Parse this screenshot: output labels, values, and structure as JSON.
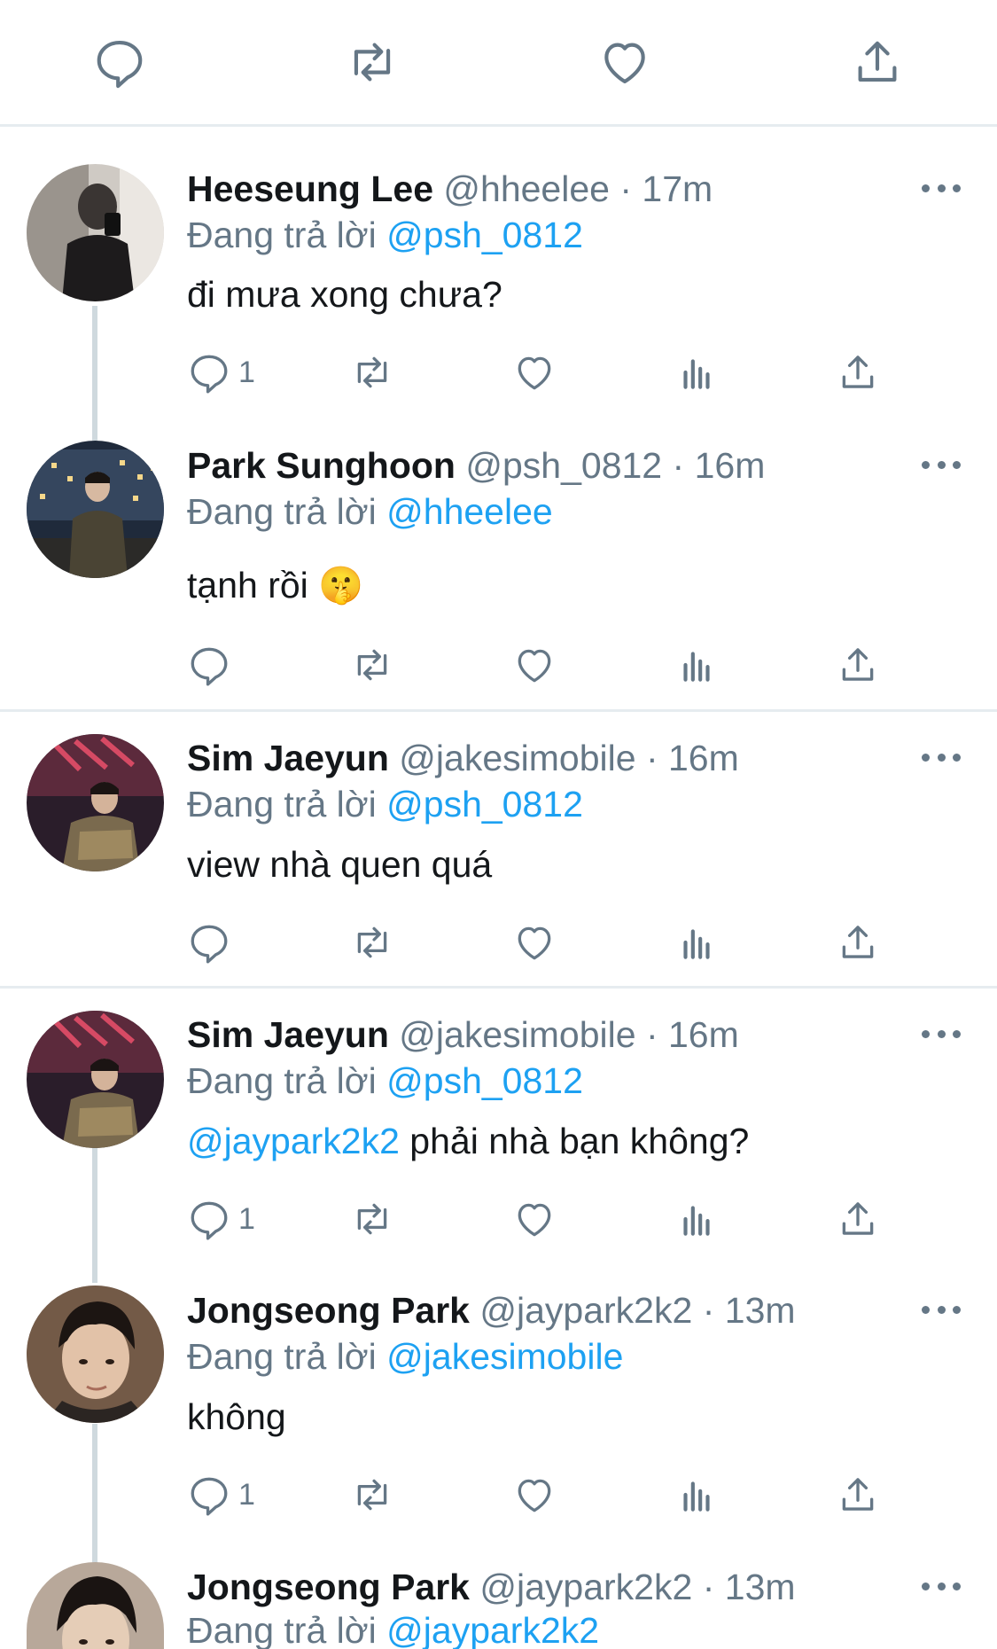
{
  "top_actions": [
    "reply",
    "retweet",
    "like",
    "share"
  ],
  "tweets": [
    {
      "name": "Heeseung Lee",
      "handle": "@hheelee",
      "time": "17m",
      "reply_prefix": "Đang trả lời",
      "reply_to": "@psh_0812",
      "text": "đi mưa xong chưa?",
      "reply_count": "1"
    },
    {
      "name": "Park Sunghoon",
      "handle": "@psh_0812",
      "time": "16m",
      "reply_prefix": "Đang trả lời",
      "reply_to": "@hheelee",
      "text": "tạnh rồi 🤫",
      "reply_count": ""
    },
    {
      "name": "Sim Jaeyun",
      "handle": "@jakesimobile",
      "time": "16m",
      "reply_prefix": "Đang trả lời",
      "reply_to": "@psh_0812",
      "text": "view nhà quen quá",
      "reply_count": ""
    },
    {
      "name": "Sim Jaeyun",
      "handle": "@jakesimobile",
      "time": "16m",
      "reply_prefix": "Đang trả lời",
      "reply_to": "@psh_0812",
      "text_mention": "@jaypark2k2",
      "text": " phải nhà bạn không?",
      "reply_count": "1"
    },
    {
      "name": "Jongseong Park",
      "handle": "@jaypark2k2",
      "time": "13m",
      "reply_prefix": "Đang trả lời",
      "reply_to": "@jakesimobile",
      "text": "không",
      "reply_count": "1"
    },
    {
      "name": "Jongseong Park",
      "handle": "@jaypark2k2",
      "time": "13m",
      "reply_prefix": "Đang trả lời",
      "reply_to": "@jaypark2k2"
    }
  ],
  "colors": {
    "accent": "#1da1f2",
    "secondary_text": "#657786",
    "divider": "#e6ecf0",
    "thread_line": "#cfd9de"
  }
}
